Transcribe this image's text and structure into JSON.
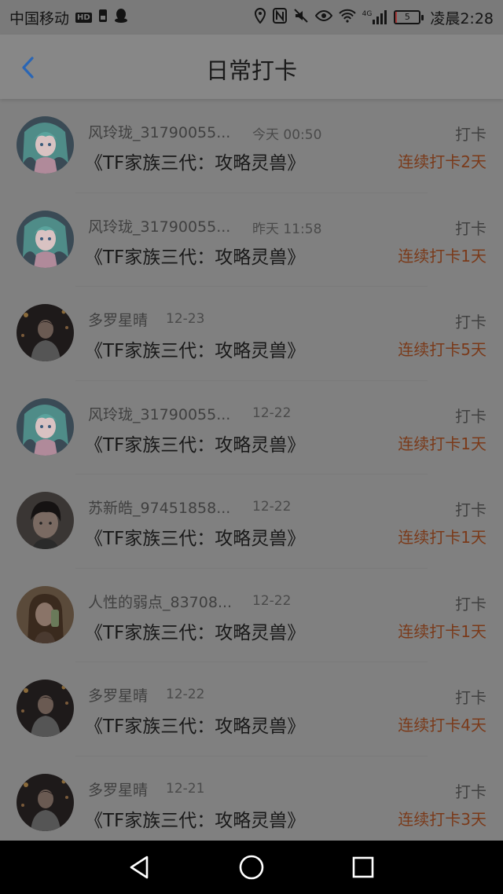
{
  "status_bar": {
    "carrier": "中国移动",
    "hd_badge": "HD",
    "network": "4G",
    "battery": "5",
    "battery_level": 0.05,
    "time": "凌晨2:28",
    "icons": [
      "sim-icon",
      "qq-icon",
      "location-icon",
      "nfc-icon",
      "mute-icon",
      "eye-icon",
      "wifi-icon",
      "signal-icon",
      "battery-icon"
    ]
  },
  "header": {
    "title": "日常打卡",
    "back_icon": "chevron-left-icon",
    "accent": "#2a66b5"
  },
  "colors": {
    "streak_text": "#7a3a1a",
    "overlay_tint": "#808080"
  },
  "checkins": [
    {
      "user": "风玲珑_31790055...",
      "time": "今天 00:50",
      "book": "《TF家族三代：攻略灵兽》",
      "action": "打卡",
      "streak": "连续打卡2天",
      "avatar": "anime"
    },
    {
      "user": "风玲珑_31790055...",
      "time": "昨天 11:58",
      "book": "《TF家族三代：攻略灵兽》",
      "action": "打卡",
      "streak": "连续打卡1天",
      "avatar": "anime"
    },
    {
      "user": "多罗星晴",
      "time": "12-23",
      "book": "《TF家族三代：攻略灵兽》",
      "action": "打卡",
      "streak": "连续打卡5天",
      "avatar": "night"
    },
    {
      "user": "风玲珑_31790055...",
      "time": "12-22",
      "book": "《TF家族三代：攻略灵兽》",
      "action": "打卡",
      "streak": "连续打卡1天",
      "avatar": "anime"
    },
    {
      "user": "苏新皓_97451858...",
      "time": "12-22",
      "book": "《TF家族三代：攻略灵兽》",
      "action": "打卡",
      "streak": "连续打卡1天",
      "avatar": "boy"
    },
    {
      "user": "人性的弱点_83708...",
      "time": "12-22",
      "book": "《TF家族三代：攻略灵兽》",
      "action": "打卡",
      "streak": "连续打卡1天",
      "avatar": "girl"
    },
    {
      "user": "多罗星晴",
      "time": "12-22",
      "book": "《TF家族三代：攻略灵兽》",
      "action": "打卡",
      "streak": "连续打卡4天",
      "avatar": "night"
    },
    {
      "user": "多罗星晴",
      "time": "12-21",
      "book": "《TF家族三代：攻略灵兽》",
      "action": "打卡",
      "streak": "连续打卡3天",
      "avatar": "night"
    }
  ],
  "nav_bar": {
    "buttons": [
      "back-triangle-icon",
      "home-circle-icon",
      "recents-square-icon"
    ]
  }
}
